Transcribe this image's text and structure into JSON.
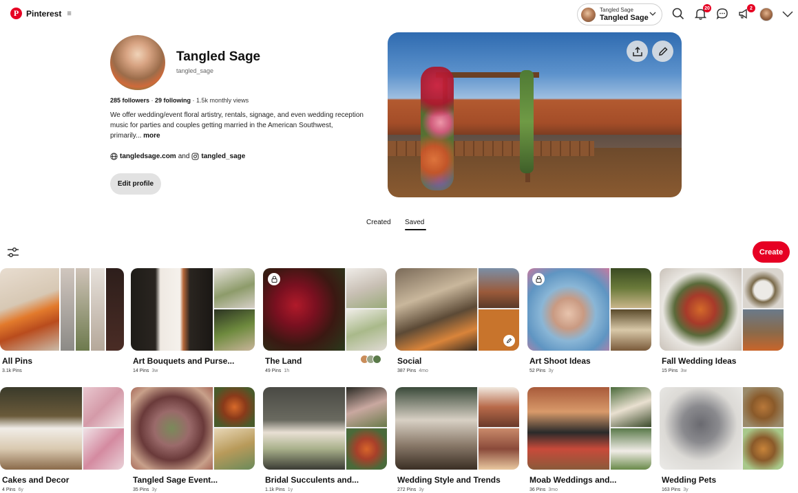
{
  "header": {
    "brand": "Pinterest",
    "account_switch": {
      "small": "Tangled Sage",
      "name": "Tangled Sage"
    },
    "notifications_badge": "20",
    "updates_badge": "2"
  },
  "profile": {
    "name": "Tangled Sage",
    "handle": "tangled_sage",
    "followers": "285 followers",
    "separator": " · ",
    "following": "29 following",
    "monthly_views": "1.5k monthly views",
    "bio": "We offer wedding/event floral artistry, rentals, signage, and even wedding reception music for parties and couples getting married in the American Southwest, primarily...",
    "bio_more": "more",
    "website": "tangledsage.com",
    "and_word": "and",
    "instagram": "tangled_sage",
    "edit_label": "Edit profile"
  },
  "tabs": {
    "created": "Created",
    "saved": "Saved"
  },
  "create_label": "Create",
  "boards": [
    {
      "title": "All Pins",
      "pins": "3.1k Pins",
      "age": ""
    },
    {
      "title": "Art Bouquets and Purse...",
      "pins": "14 Pins",
      "age": "3w"
    },
    {
      "title": "The Land",
      "pins": "49 Pins",
      "age": "1h"
    },
    {
      "title": "Social",
      "pins": "387 Pins",
      "age": "4mo"
    },
    {
      "title": "Art Shoot Ideas",
      "pins": "52 Pins",
      "age": "3y"
    },
    {
      "title": "Fall Wedding Ideas",
      "pins": "15 Pins",
      "age": "3w"
    },
    {
      "title": "Cakes and Decor",
      "pins": "4 Pins",
      "age": "6y"
    },
    {
      "title": "Tangled Sage Event...",
      "pins": "35 Pins",
      "age": "3y"
    },
    {
      "title": "Bridal Succulents and...",
      "pins": "1.1k Pins",
      "age": "1y"
    },
    {
      "title": "Wedding Style and Trends",
      "pins": "272 Pins",
      "age": "3y"
    },
    {
      "title": "Moab Weddings and...",
      "pins": "36 Pins",
      "age": "3mo"
    },
    {
      "title": "Wedding Pets",
      "pins": "163 Pins",
      "age": "3y"
    }
  ],
  "colors": {
    "accent": "#e60023",
    "button_gray": "#e2e2e2"
  }
}
